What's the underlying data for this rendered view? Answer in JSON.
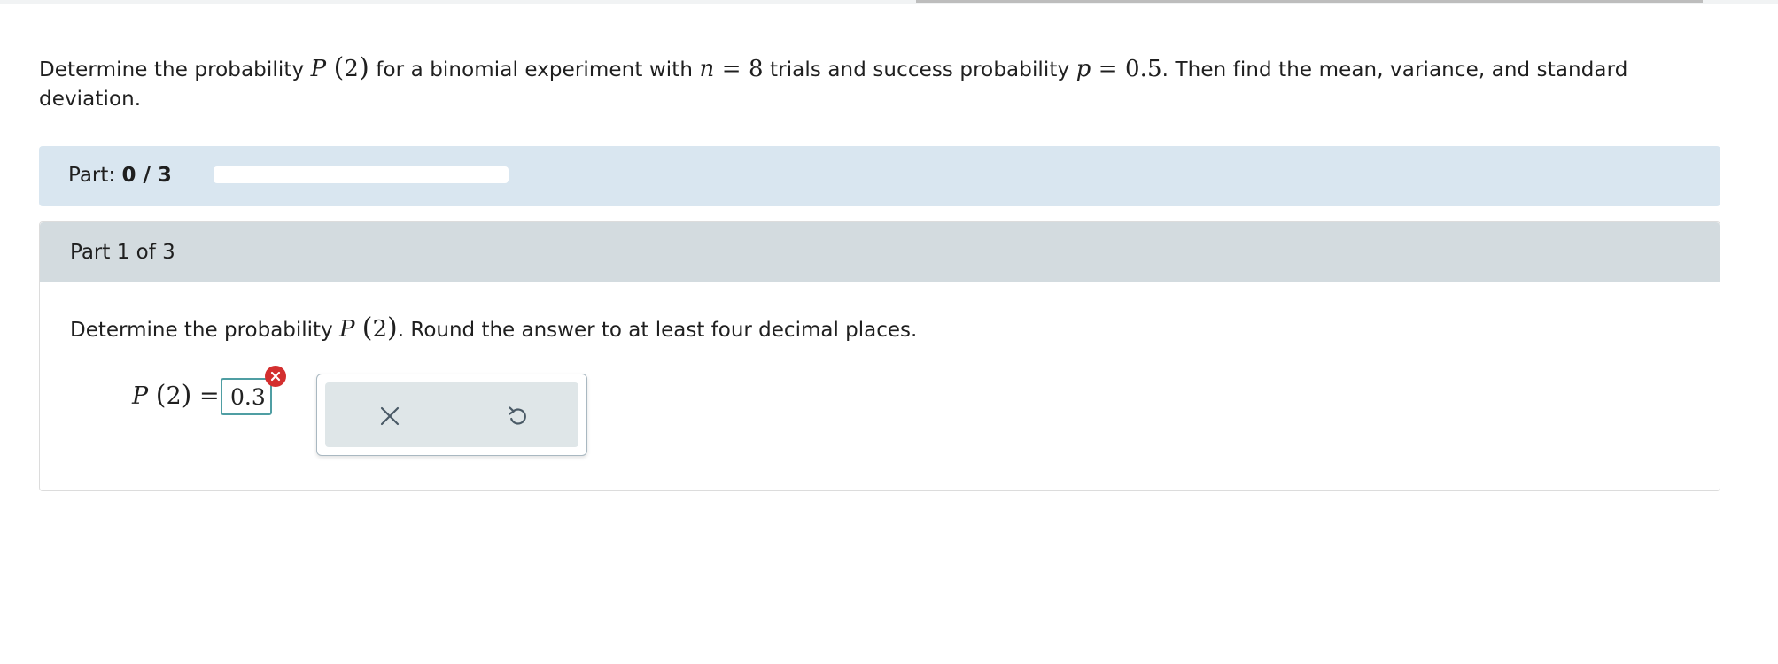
{
  "question": {
    "prefix": "Determine the probability ",
    "p_symbol": "P",
    "p_arg": "2",
    "mid1": " for a binomial experiment with ",
    "n_var": "n",
    "n_eq": " = 8",
    "mid2": " trials and success probability ",
    "p_var": "p",
    "p_eq": " = 0.5",
    "suffix": ". Then find the mean, variance, and standard deviation."
  },
  "progress": {
    "label": "Part:",
    "value_text": "0 / 3",
    "completed": 0,
    "total": 3,
    "fraction": 0
  },
  "part": {
    "header": "Part 1 of 3",
    "instruction_prefix": "Determine the probability ",
    "instruction_p": "P",
    "instruction_arg": "2",
    "instruction_suffix": ". Round the answer to at least four decimal places.",
    "answer_label_p": "P",
    "answer_label_arg": "2",
    "answer_label_eq": " =",
    "answer_value": "0.3",
    "answer_status": "incorrect"
  },
  "tools": {
    "clear_icon": "close-icon",
    "undo_icon": "undo-icon"
  },
  "colors": {
    "progress_bg": "#d9e6f0",
    "header_bg": "#d3dbdf",
    "input_border": "#4f9ea3",
    "error": "#d32f2f",
    "tool_bg": "#dfe6e8",
    "icon": "#4a5a66"
  }
}
